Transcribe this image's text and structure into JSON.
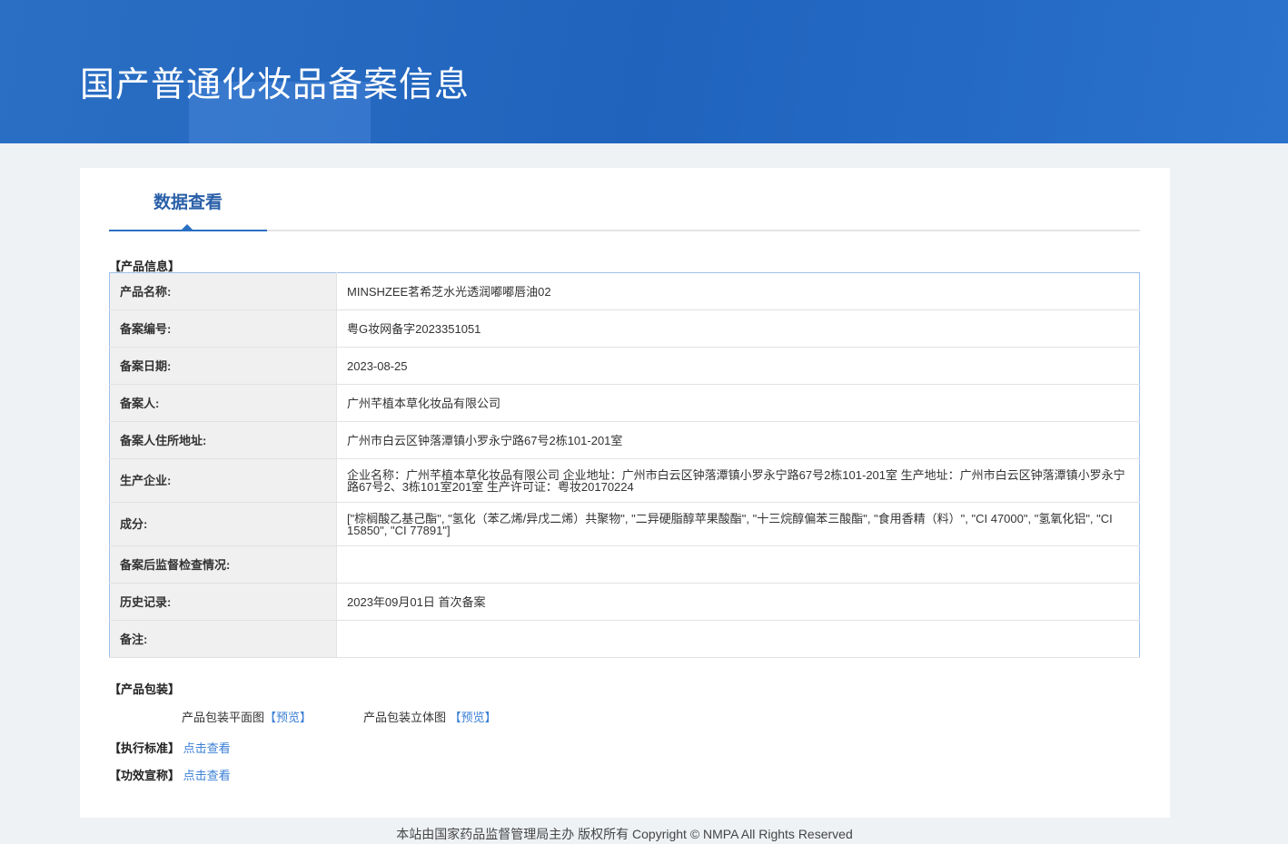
{
  "header": {
    "title": "国产普通化妆品备案信息"
  },
  "tab": {
    "label": "数据查看"
  },
  "product_info": {
    "heading": "【产品信息】",
    "rows": [
      {
        "label": "产品名称:",
        "value": "MINSHZEE茗希芝水光透润嘟嘟唇油02"
      },
      {
        "label": "备案编号:",
        "value": "粤G妆网备字2023351051"
      },
      {
        "label": "备案日期:",
        "value": "2023-08-25"
      },
      {
        "label": "备案人:",
        "value": "广州芊植本草化妆品有限公司"
      },
      {
        "label": "备案人住所地址:",
        "value": "广州市白云区钟落潭镇小罗永宁路67号2栋101-201室"
      },
      {
        "label": "生产企业:",
        "value": "企业名称：广州芊植本草化妆品有限公司 企业地址：广州市白云区钟落潭镇小罗永宁路67号2栋101-201室 生产地址：广州市白云区钟落潭镇小罗永宁路67号2、3栋101室201室 生产许可证：粤妆20170224"
      },
      {
        "label": "成分:",
        "value": "[\"棕榈酸乙基己酯\", \"氢化（苯乙烯/异戊二烯）共聚物\", \"二异硬脂醇苹果酸酯\", \"十三烷醇偏苯三酸酯\", \"食用香精（料）\", \"CI 47000\", \"氢氧化铝\", \"CI 15850\", \"CI 77891\"]"
      },
      {
        "label": "备案后监督检查情况:",
        "value": ""
      },
      {
        "label": "历史记录:",
        "value": "2023年09月01日 首次备案"
      },
      {
        "label": "备注:",
        "value": ""
      }
    ]
  },
  "packaging": {
    "heading": "【产品包装】",
    "flat_label": "产品包装平面图",
    "flat_link": "【预览】",
    "solid_label": "产品包装立体图",
    "solid_link": "【预览】"
  },
  "standard": {
    "heading": "【执行标准】",
    "link": "点击查看"
  },
  "efficacy": {
    "heading": "【功效宣称】",
    "link": "点击查看"
  },
  "footer": {
    "text": "本站由国家药品监督管理局主办 版权所有 Copyright © NMPA All Rights Reserved"
  }
}
